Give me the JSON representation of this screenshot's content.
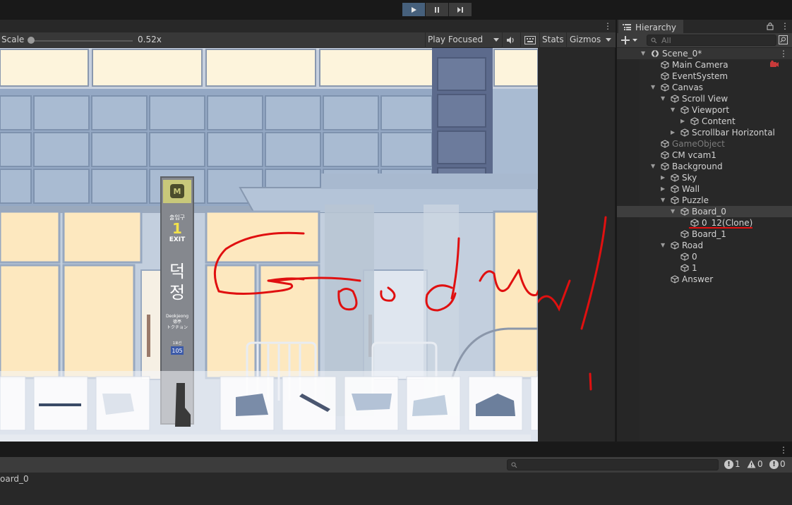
{
  "toolbar": {
    "controls": [
      "play",
      "pause",
      "step"
    ]
  },
  "game_view": {
    "scale_label": "Scale",
    "scale_value": "0.52x",
    "play_mode": "Play Focused",
    "stats_label": "Stats",
    "gizmos_label": "Gizmos",
    "scene_sign": {
      "line_1": "출입구",
      "number": "1",
      "exit": "EXIT",
      "station_char_1": "덕",
      "station_char_2": "정",
      "romanized": "Deokjeong",
      "hanja": "德亭",
      "katakana": "トクチョン",
      "line_label": "1호선",
      "station_code": "105"
    }
  },
  "hierarchy": {
    "title": "Hierarchy",
    "search_placeholder": "All",
    "items": [
      {
        "label": "Scene_0*",
        "depth": 0,
        "expander": "open",
        "kind": "scene"
      },
      {
        "label": "Main Camera",
        "depth": 1,
        "expander": "none"
      },
      {
        "label": "EventSystem",
        "depth": 1,
        "expander": "none"
      },
      {
        "label": "Canvas",
        "depth": 1,
        "expander": "open"
      },
      {
        "label": "Scroll View",
        "depth": 2,
        "expander": "open"
      },
      {
        "label": "Viewport",
        "depth": 3,
        "expander": "open"
      },
      {
        "label": "Content",
        "depth": 4,
        "expander": "closed"
      },
      {
        "label": "Scrollbar Horizontal",
        "depth": 3,
        "expander": "closed"
      },
      {
        "label": "GameObject",
        "depth": 1,
        "expander": "none",
        "dim": true
      },
      {
        "label": "CM vcam1",
        "depth": 1,
        "expander": "none"
      },
      {
        "label": "Background",
        "depth": 1,
        "expander": "open"
      },
      {
        "label": "Sky",
        "depth": 2,
        "expander": "closed"
      },
      {
        "label": "Wall",
        "depth": 2,
        "expander": "closed"
      },
      {
        "label": "Puzzle",
        "depth": 2,
        "expander": "open"
      },
      {
        "label": "Board_0",
        "depth": 3,
        "expander": "open",
        "selected": true
      },
      {
        "label": "0_12(Clone)",
        "depth": 4,
        "expander": "none",
        "underlined": true
      },
      {
        "label": "Board_1",
        "depth": 3,
        "expander": "none"
      },
      {
        "label": "Road",
        "depth": 2,
        "expander": "open"
      },
      {
        "label": "0",
        "depth": 3,
        "expander": "none"
      },
      {
        "label": "1",
        "depth": 3,
        "expander": "none"
      },
      {
        "label": "Answer",
        "depth": 2,
        "expander": "none"
      }
    ]
  },
  "console": {
    "info_count": "1",
    "warning_count": "0",
    "error_count": "0",
    "last_message": "oard_0"
  },
  "colors": {
    "accent": "#46607c",
    "annotation": "#e01010"
  }
}
